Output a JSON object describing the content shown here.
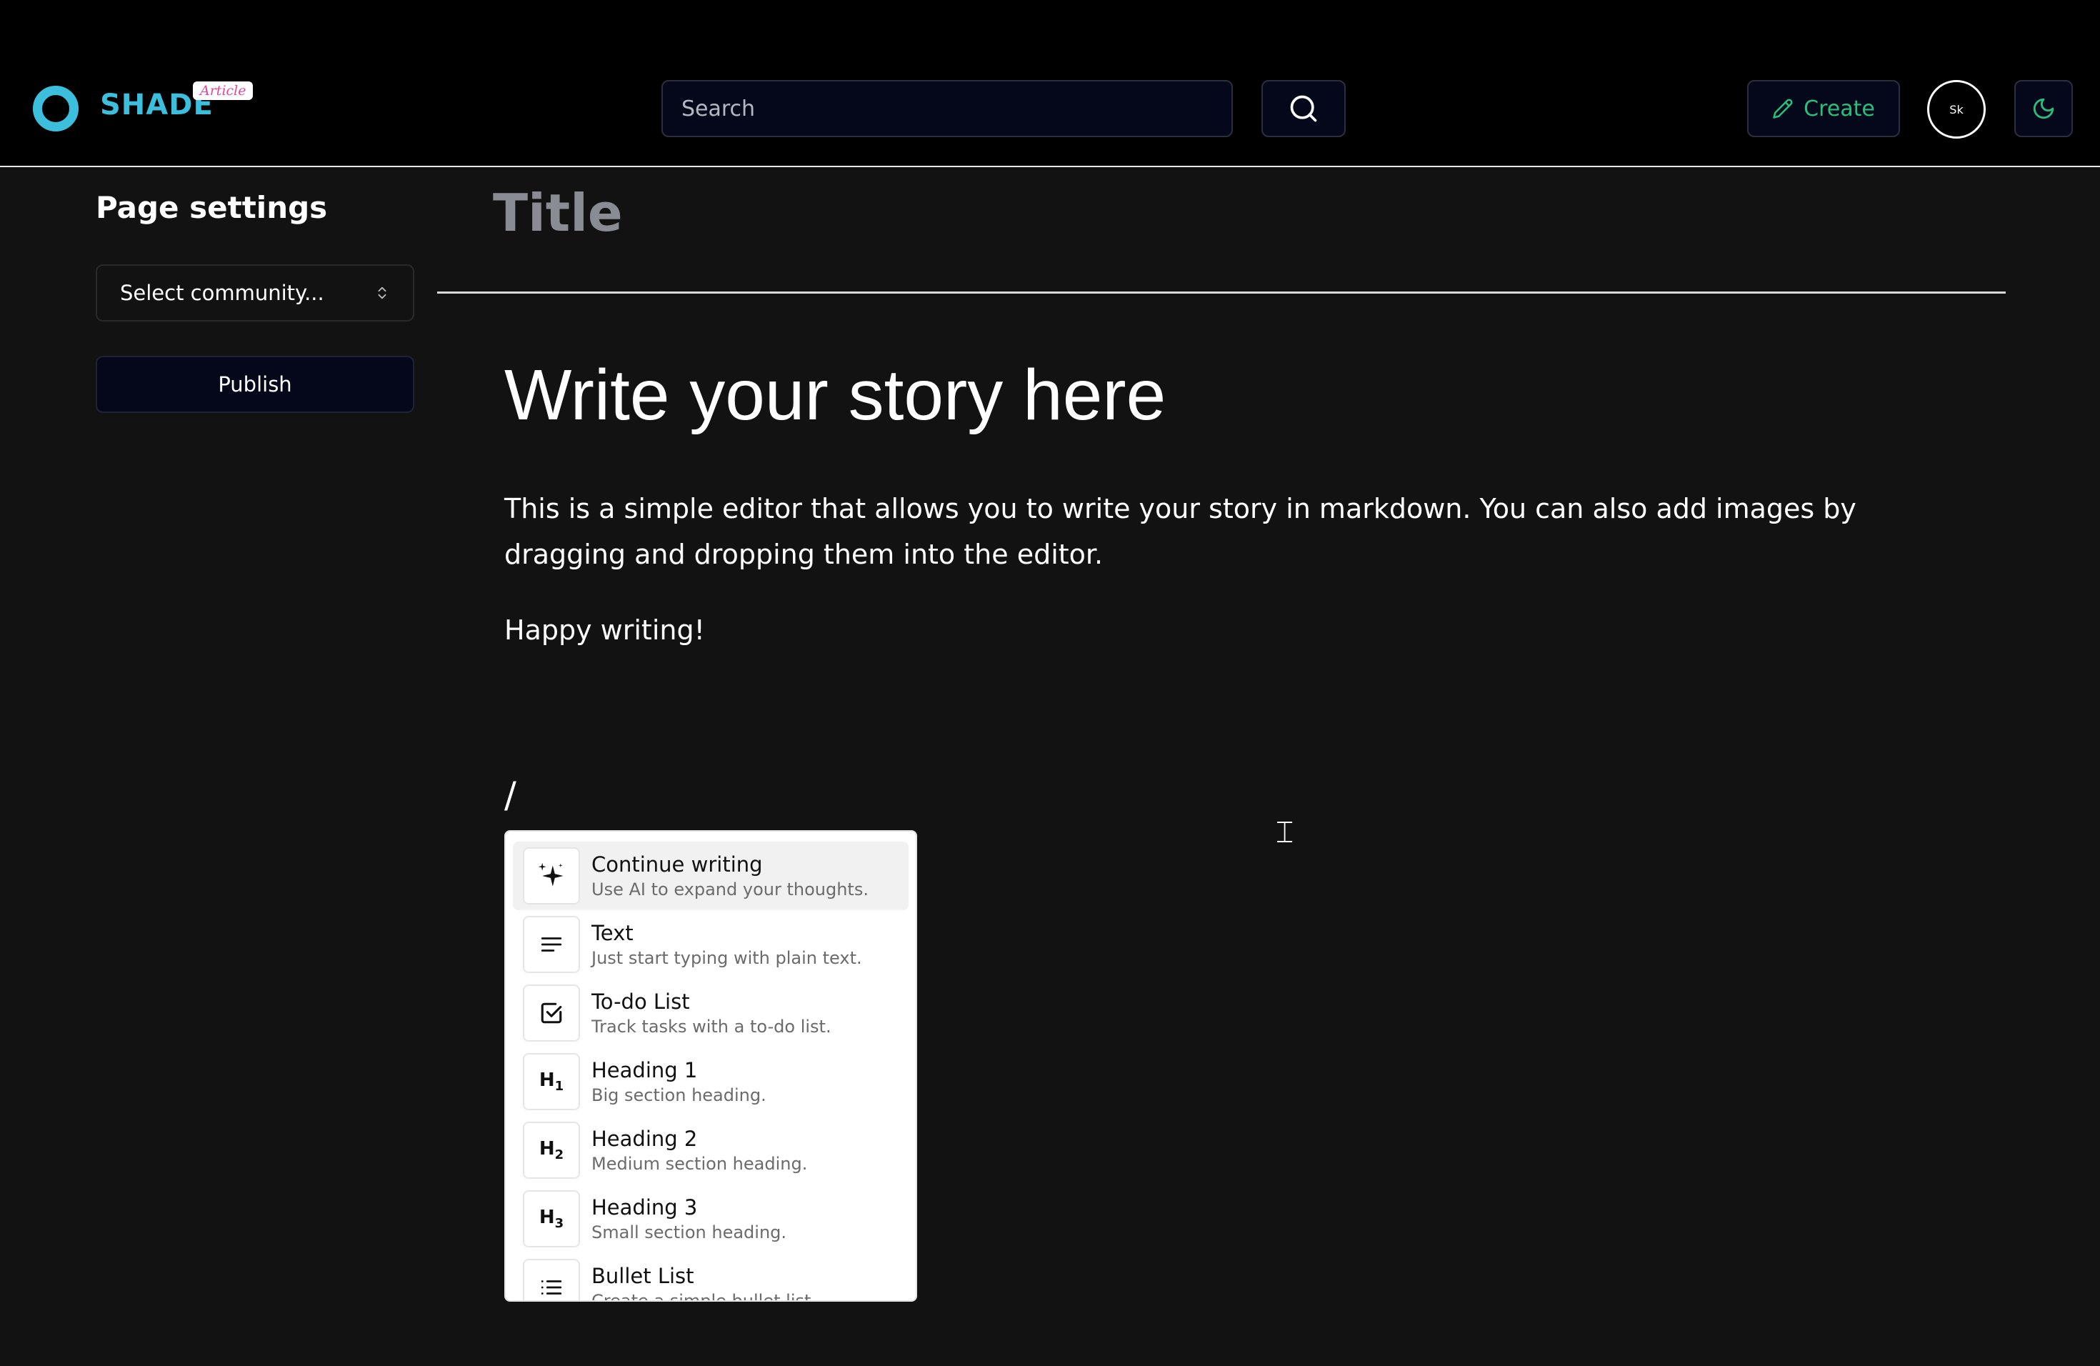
{
  "header": {
    "logo_text": "SHADE",
    "logo_badge": "Article",
    "search_placeholder": "Search",
    "create_label": "Create",
    "avatar_text": "Sk"
  },
  "sidebar": {
    "title": "Page settings",
    "community_select": "Select community...",
    "publish_label": "Publish"
  },
  "editor": {
    "title_placeholder": "Title",
    "heading": "Write your story here",
    "paragraph1": "This is a simple editor that allows you to write your story in markdown. You can also add images by dragging and dropping them into the editor.",
    "paragraph2": "Happy writing!",
    "slash": "/"
  },
  "command_menu": {
    "items": [
      {
        "title": "Continue writing",
        "description": "Use AI to expand your thoughts.",
        "icon": "sparkles-icon"
      },
      {
        "title": "Text",
        "description": "Just start typing with plain text.",
        "icon": "text-icon"
      },
      {
        "title": "To-do List",
        "description": "Track tasks with a to-do list.",
        "icon": "checkbox-icon"
      },
      {
        "title": "Heading 1",
        "description": "Big section heading.",
        "icon": "heading1-icon",
        "glyph": "H1"
      },
      {
        "title": "Heading 2",
        "description": "Medium section heading.",
        "icon": "heading2-icon",
        "glyph": "H2"
      },
      {
        "title": "Heading 3",
        "description": "Small section heading.",
        "icon": "heading3-icon",
        "glyph": "H3"
      },
      {
        "title": "Bullet List",
        "description": "Create a simple bullet list.",
        "icon": "bullet-list-icon"
      }
    ]
  },
  "colors": {
    "brand": "#3bbfdc",
    "create_accent": "#27c07a",
    "background": "#121212",
    "header_bg": "#000000"
  }
}
